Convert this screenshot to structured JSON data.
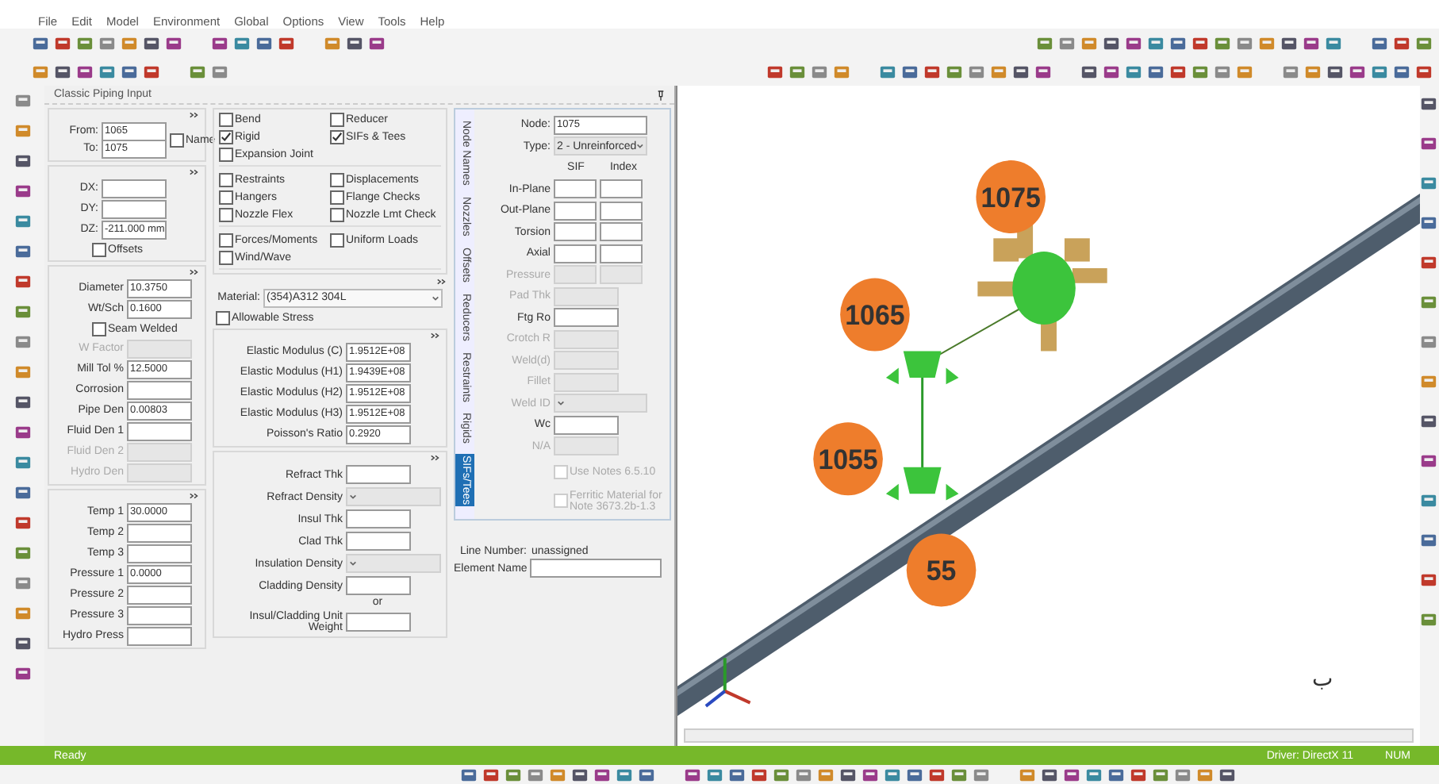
{
  "menu": [
    "File",
    "Edit",
    "Model",
    "Environment",
    "Global",
    "Options",
    "View",
    "Tools",
    "Help"
  ],
  "panel": {
    "title": "Classic Piping Input"
  },
  "nodes": {
    "fields": [
      {
        "label": "From:",
        "value": "1065"
      },
      {
        "label": "To:",
        "value": "1075"
      }
    ],
    "name": {
      "label": "Name",
      "checked": false
    }
  },
  "deltas": {
    "fields": [
      {
        "label": "DX:"
      },
      {
        "label": "DY:"
      },
      {
        "label": "DZ:",
        "value": "-211.000 mm"
      }
    ],
    "offsets": {
      "label": "Offsets",
      "checked": false
    }
  },
  "pipe": {
    "fields": [
      {
        "label": "Diameter",
        "value": "10.3750",
        "disabled": false
      },
      {
        "label": "Wt/Sch",
        "value": "0.1600",
        "disabled": false
      }
    ],
    "seam_welded": {
      "label": "Seam Welded",
      "checked": false
    },
    "more": [
      {
        "label": "W Factor",
        "disabled": true
      },
      {
        "label": "Mill Tol %",
        "value": "12.5000",
        "disabled": false
      },
      {
        "label": "Corrosion",
        "disabled": false
      },
      {
        "label": "Pipe Den",
        "value": "0.00803",
        "disabled": false
      },
      {
        "label": "Fluid Den 1",
        "disabled": false
      },
      {
        "label": "Fluid Den 2",
        "disabled": true
      },
      {
        "label": "Hydro Den",
        "disabled": true
      }
    ]
  },
  "operating": [
    {
      "label": "Temp 1",
      "value": "30.0000"
    },
    {
      "label": "Temp 2"
    },
    {
      "label": "Temp 3"
    },
    {
      "label": "Pressure 1",
      "value": "0.0000"
    },
    {
      "label": "Pressure 2"
    },
    {
      "label": "Pressure 3"
    },
    {
      "label": "Hydro Press"
    }
  ],
  "element_options": [
    [
      {
        "label": "Bend",
        "checked": false
      },
      {
        "label": "Reducer",
        "checked": false
      },
      {
        "label": "Rigid",
        "checked": true
      },
      {
        "label": "SIFs & Tees",
        "checked": true
      },
      {
        "label": "Expansion Joint",
        "checked": false
      }
    ],
    [
      {
        "label": "Restraints",
        "checked": false
      },
      {
        "label": "Displacements",
        "checked": false
      },
      {
        "label": "Hangers",
        "checked": false
      },
      {
        "label": "Flange Checks",
        "checked": false
      },
      {
        "label": "Nozzle Flex",
        "checked": false
      },
      {
        "label": "Nozzle Lmt Check",
        "checked": false
      }
    ],
    [
      {
        "label": "Forces/Moments",
        "checked": false
      },
      {
        "label": "Uniform Loads",
        "checked": false
      },
      {
        "label": "Wind/Wave",
        "checked": false
      }
    ]
  ],
  "material": {
    "label": "Material:",
    "value": "(354)A312 304L",
    "allowable_stress": {
      "label": "Allowable Stress",
      "checked": false
    }
  },
  "elastic": [
    {
      "label": "Elastic Modulus (C)",
      "value": "1.9512E+08"
    },
    {
      "label": "Elastic Modulus (H1)",
      "value": "1.9439E+08"
    },
    {
      "label": "Elastic Modulus (H2)",
      "value": "1.9512E+08"
    },
    {
      "label": "Elastic Modulus (H3)",
      "value": "1.9512E+08"
    },
    {
      "label": "Poisson's Ratio",
      "value": "0.2920"
    }
  ],
  "insulation": [
    {
      "kind": "field",
      "label": "Refract Thk"
    },
    {
      "kind": "dropdown",
      "label": "Refract Density"
    },
    {
      "kind": "field",
      "label": "Insul Thk"
    },
    {
      "kind": "field",
      "label": "Clad Thk"
    },
    {
      "kind": "dropdown",
      "label": "Insulation Density"
    },
    {
      "kind": "field",
      "label": "Cladding Density"
    },
    {
      "kind": "note",
      "label": "or"
    },
    {
      "kind": "field",
      "label": "Insul/Cladding Unit Weight"
    }
  ],
  "aux_tabs": [
    {
      "label": "Node Names",
      "selected": false
    },
    {
      "label": "Nozzles",
      "selected": false
    },
    {
      "label": "Offsets",
      "selected": false
    },
    {
      "label": "Reducers",
      "selected": false
    },
    {
      "label": "Restraints",
      "selected": false
    },
    {
      "label": "Rigids",
      "selected": false
    },
    {
      "label": "SIFs/Tees",
      "selected": true
    }
  ],
  "sif": {
    "node": {
      "label": "Node:",
      "value": "1075"
    },
    "type": {
      "label": "Type:",
      "value": "2 - Unreinforced"
    },
    "columns": [
      "SIF",
      "Index"
    ],
    "factors": [
      {
        "label": "In-Plane",
        "disabled": false
      },
      {
        "label": "Out-Plane",
        "disabled": false
      },
      {
        "label": "Torsion",
        "disabled": false
      },
      {
        "label": "Axial",
        "disabled": false
      },
      {
        "label": "Pressure",
        "disabled": true
      }
    ],
    "fields": [
      {
        "kind": "field",
        "label": "Pad Thk",
        "disabled": true
      },
      {
        "kind": "field",
        "label": "Ftg Ro",
        "disabled": false
      },
      {
        "kind": "field",
        "label": "Crotch R",
        "disabled": true
      },
      {
        "kind": "field",
        "label": "Weld(d)",
        "disabled": true
      },
      {
        "kind": "field",
        "label": "Fillet",
        "disabled": true
      },
      {
        "kind": "dropdown",
        "label": "Weld ID",
        "disabled": true
      },
      {
        "kind": "field",
        "label": "Wc",
        "disabled": false
      },
      {
        "kind": "field",
        "label": "N/A",
        "disabled": true
      }
    ],
    "options": [
      {
        "label": "Use Notes 6.5.10",
        "disabled": true
      },
      {
        "label": "Ferritic Material for Note 3673.2b-1.3",
        "disabled": true
      }
    ]
  },
  "line_number": {
    "label": "Line Number:",
    "value": "unassigned"
  },
  "element_name": {
    "label": "Element Name"
  },
  "viewport": {
    "nodes": [
      "1075",
      "1065",
      "1055",
      "55"
    ],
    "figure_label": "ب"
  },
  "status_bar": {
    "text": "Ready",
    "driver": "Driver: DirectX 11",
    "num": "NUM"
  }
}
